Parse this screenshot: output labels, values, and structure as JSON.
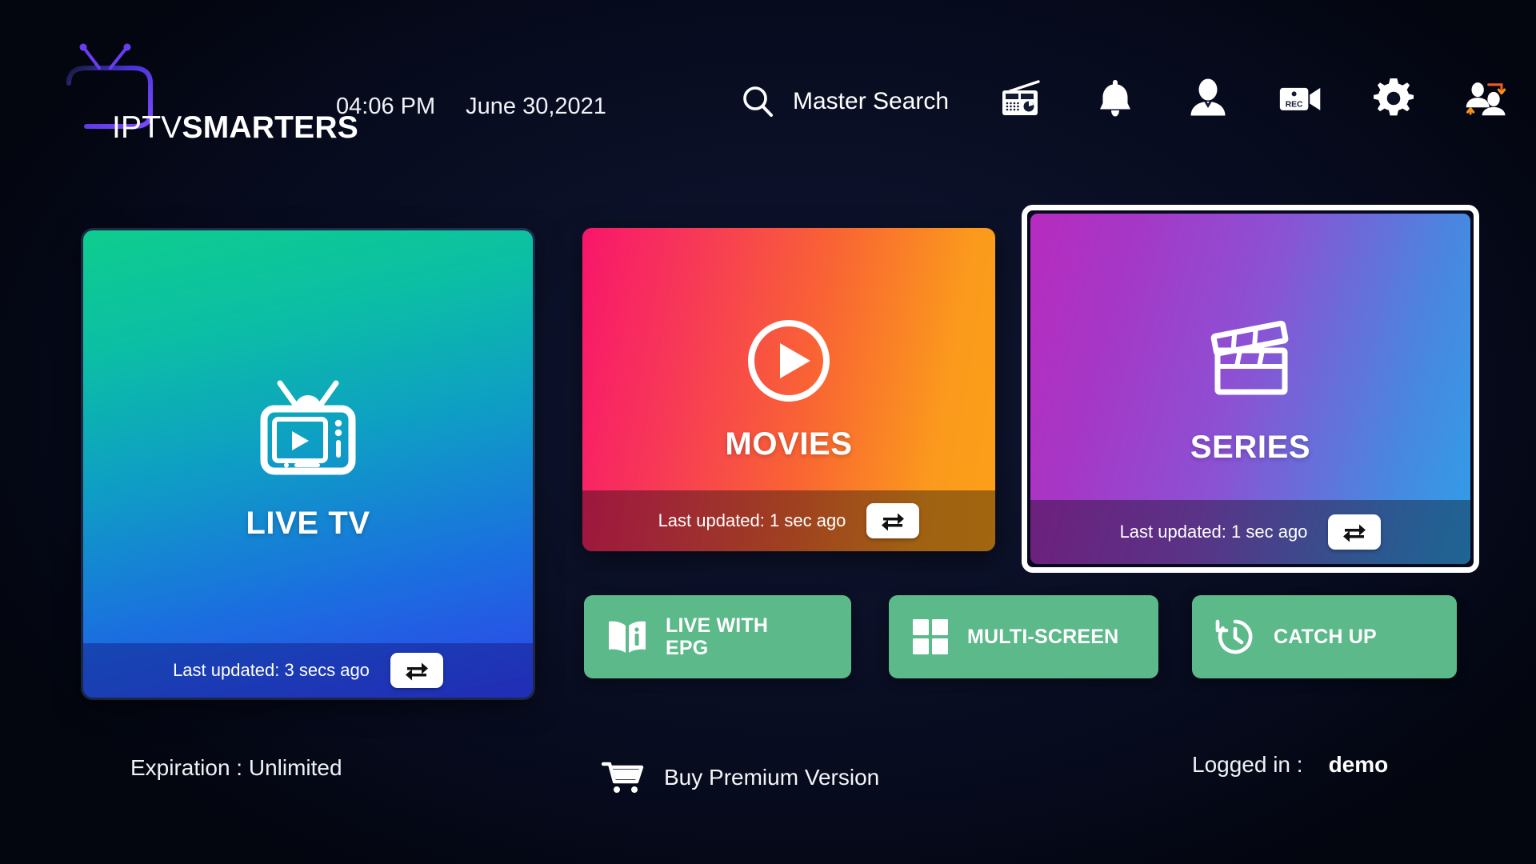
{
  "header": {
    "brand": {
      "prefix": "IPTV",
      "suffix": "SMARTERS",
      "logo_icon": "tv-antenna-logo-icon"
    },
    "time": "04:06 PM",
    "date": "June 30,2021",
    "master_search": {
      "label": "Master Search",
      "icon": "search-icon"
    },
    "icons": [
      {
        "name": "radio-icon",
        "label": "Radio"
      },
      {
        "name": "bell-icon",
        "label": "Notifications"
      },
      {
        "name": "person-icon",
        "label": "Account"
      },
      {
        "name": "rec-camera-icon",
        "label": "REC"
      },
      {
        "name": "gear-icon",
        "label": "Settings"
      },
      {
        "name": "switch-user-icon",
        "label": "Switch User"
      }
    ]
  },
  "cards": [
    {
      "id": "livetv",
      "title": "LIVE TV",
      "icon": "retro-tv-icon",
      "last_updated": "Last updated: 3 secs ago",
      "refresh_icon": "refresh-sync-icon",
      "gradient_from": "#0ecd8e",
      "gradient_to": "#2f43e8",
      "focused": false
    },
    {
      "id": "movies",
      "title": "MOVIES",
      "icon": "play-circle-icon",
      "last_updated": "Last updated: 1 sec ago",
      "refresh_icon": "refresh-sync-icon",
      "gradient_from": "#f8166b",
      "gradient_to": "#fca017",
      "focused": false
    },
    {
      "id": "series",
      "title": "SERIES",
      "icon": "clapperboard-icon",
      "last_updated": "Last updated: 1 sec ago",
      "refresh_icon": "refresh-sync-icon",
      "gradient_from": "#b62bbf",
      "gradient_to": "#2e9fe8",
      "focused": true
    }
  ],
  "quick_buttons": [
    {
      "id": "epg",
      "label": "LIVE WITH\nEPG",
      "label_line1": "LIVE WITH",
      "label_line2": "EPG",
      "icon": "book-info-icon",
      "color": "#5cb98a"
    },
    {
      "id": "multi",
      "label": "MULTI-SCREEN",
      "icon": "grid-four-squares-icon",
      "color": "#5cb98a"
    },
    {
      "id": "catch",
      "label": "CATCH UP",
      "icon": "clock-history-icon",
      "color": "#5cb98a"
    }
  ],
  "footer": {
    "expiration": "Expiration : Unlimited",
    "buy_premium": {
      "label": "Buy Premium Version",
      "icon": "shopping-cart-icon"
    },
    "logged_in_label": "Logged in :",
    "logged_in_user": "demo"
  },
  "theme": {
    "background": "#05081a",
    "accent_purple": "#6a3df5",
    "green_button": "#5cb98a",
    "focus_ring": "#ffffff"
  }
}
